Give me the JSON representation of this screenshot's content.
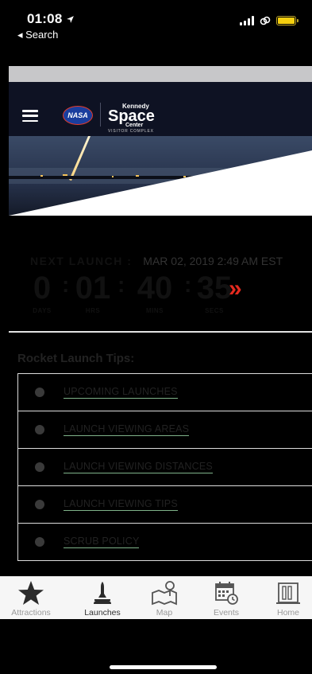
{
  "status_bar": {
    "time": "01:08",
    "back_label": "◂ Search"
  },
  "header": {
    "nasa_logo_text": "NASA",
    "ksc_logo": {
      "kennedy": "Kennedy",
      "space": "Space",
      "center": "Center",
      "visitor_complex": "VISITOR COMPLEX"
    }
  },
  "countdown": {
    "label": "NEXT LAUNCH :",
    "date": "MAR 02, 2019 2:49 AM EST",
    "days": "0",
    "days_label": "DAYS",
    "hrs": "01",
    "hrs_label": "HRS",
    "mins": "40",
    "mins_label": "MINS",
    "secs": "35",
    "secs_label": "SECS",
    "separator": ":",
    "chevrons": "»",
    "accent_color": "#e52a1f"
  },
  "tips": {
    "title": "Rocket Launch Tips:",
    "items": [
      {
        "label": "UPCOMING LAUNCHES"
      },
      {
        "label": "LAUNCH VIEWING AREAS"
      },
      {
        "label": "LAUNCH VIEWING DISTANCES"
      },
      {
        "label": "LAUNCH VIEWING TIPS"
      },
      {
        "label": "SCRUB POLICY"
      }
    ]
  },
  "tabbar": {
    "tabs": [
      {
        "label": "Attractions",
        "icon": "star-icon"
      },
      {
        "label": "Launches",
        "icon": "rocket-icon",
        "active": true
      },
      {
        "label": "Map",
        "icon": "map-pin-icon"
      },
      {
        "label": "Events",
        "icon": "calendar-clock-icon"
      },
      {
        "label": "Home",
        "icon": "building-icon"
      }
    ]
  }
}
